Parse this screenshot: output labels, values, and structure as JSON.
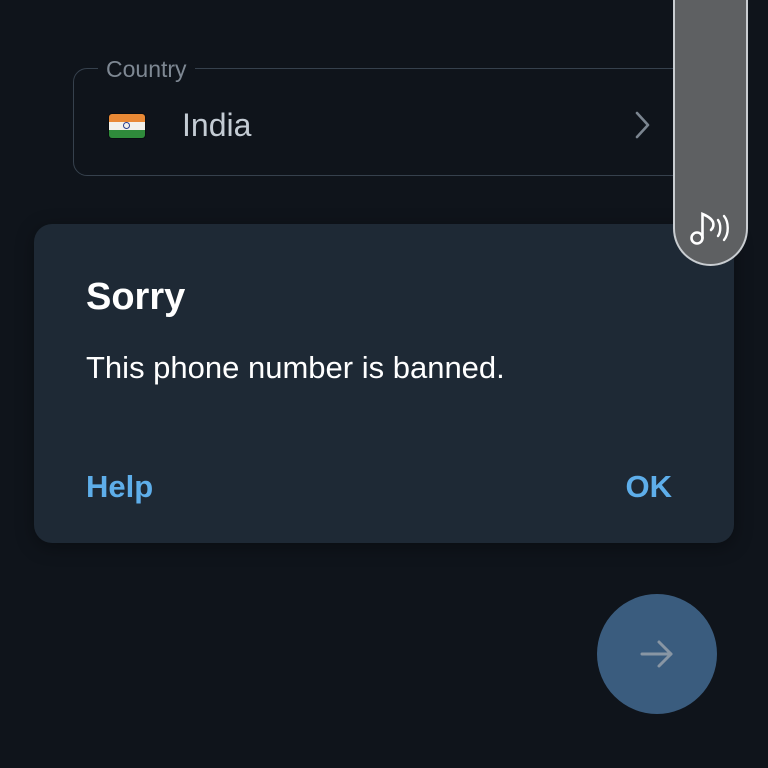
{
  "country_field": {
    "label": "Country",
    "value": "India",
    "flag_icon": "india-flag-icon",
    "chevron_icon": "chevron-right-icon"
  },
  "dialog": {
    "title": "Sorry",
    "message": "This phone number is banned.",
    "help_label": "Help",
    "ok_label": "OK"
  },
  "overlay": {
    "icon": "music-note-sound-icon"
  },
  "fab": {
    "icon": "arrow-right-icon"
  },
  "colors": {
    "background": "#0f141b",
    "dialog_background": "#1e2935",
    "accent": "#5eaeea",
    "fab_background": "#3a5c7e"
  }
}
